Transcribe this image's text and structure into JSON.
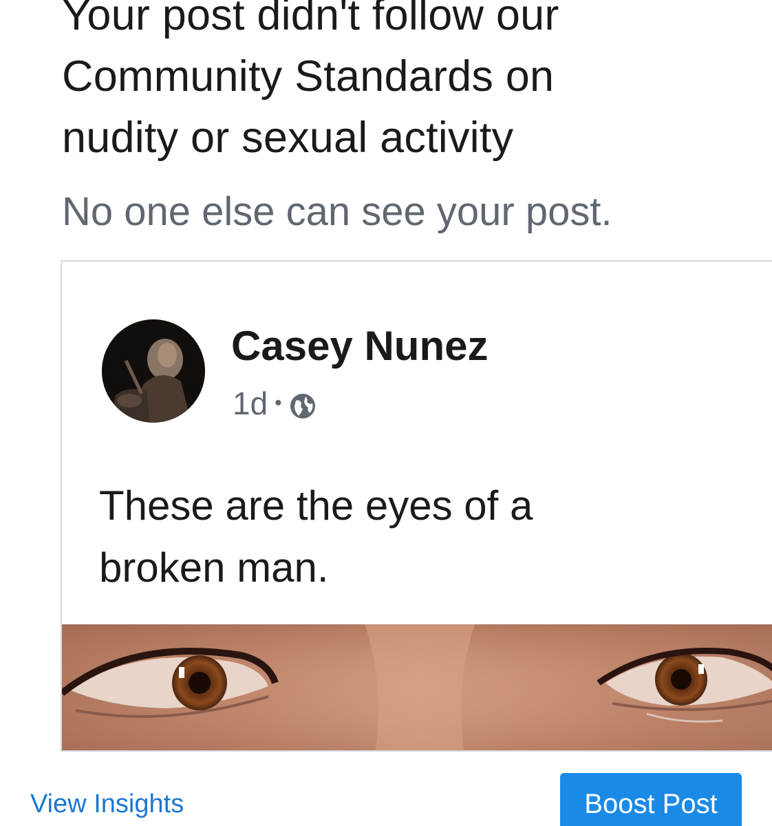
{
  "notice": {
    "headline_lines": [
      "Your post didn't follow our",
      "Community Standards on",
      "nudity or sexual activity"
    ],
    "subtitle": "No one else can see your post."
  },
  "post": {
    "author": "Casey Nunez",
    "time": "1d",
    "separator": "•",
    "privacy_icon": "globe-icon",
    "text_lines": [
      "These are the eyes of a",
      "broken man."
    ]
  },
  "actions": {
    "view_insights_label": "View Insights",
    "boost_label": "Boost Post"
  },
  "colors": {
    "primary_text": "#1a1a1a",
    "secondary_text": "#616770",
    "link": "#1a77d2",
    "button_bg": "#1b8ae6",
    "border": "#d6d8dc"
  }
}
